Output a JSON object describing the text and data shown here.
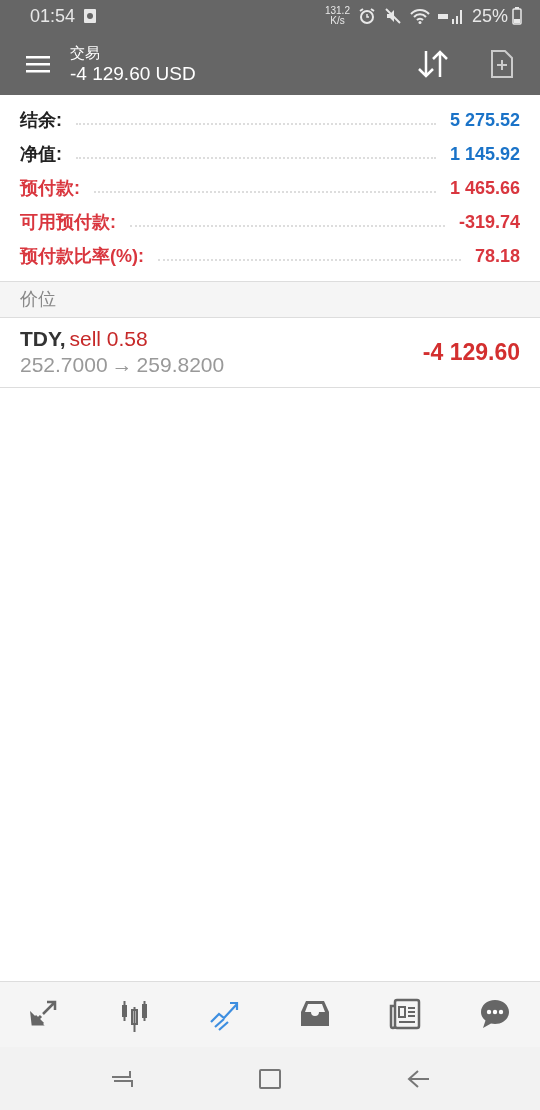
{
  "status_bar": {
    "time": "01:54",
    "net_speed": "131.2",
    "net_unit": "K/s",
    "battery": "25%"
  },
  "app_bar": {
    "title": "交易",
    "subtitle": "-4 129.60 USD"
  },
  "summary": [
    {
      "label": "结余:",
      "value": "5 275.52",
      "color": "#1a73c8"
    },
    {
      "label": "净值:",
      "value": "1 145.92",
      "color": "#1a73c8"
    },
    {
      "label": "预付款:",
      "value": "1 465.66",
      "color": "#d9363e"
    },
    {
      "label": "可用预付款:",
      "value": "-319.74",
      "color": "#d9363e"
    },
    {
      "label": "预付款比率(%):",
      "value": "78.18",
      "color": "#d9363e"
    }
  ],
  "section_header": "价位",
  "positions": [
    {
      "symbol": "TDY,",
      "side": "sell 0.58",
      "open_price": "252.7000",
      "arrow": "→",
      "current_price": "259.8200",
      "profit": "-4 129.60"
    }
  ],
  "bottom_nav": [
    {
      "kind": "quotes",
      "selected": false
    },
    {
      "kind": "chart",
      "selected": false
    },
    {
      "kind": "trade",
      "selected": true
    },
    {
      "kind": "history",
      "selected": false
    },
    {
      "kind": "news",
      "selected": false
    },
    {
      "kind": "chat",
      "selected": false
    }
  ]
}
